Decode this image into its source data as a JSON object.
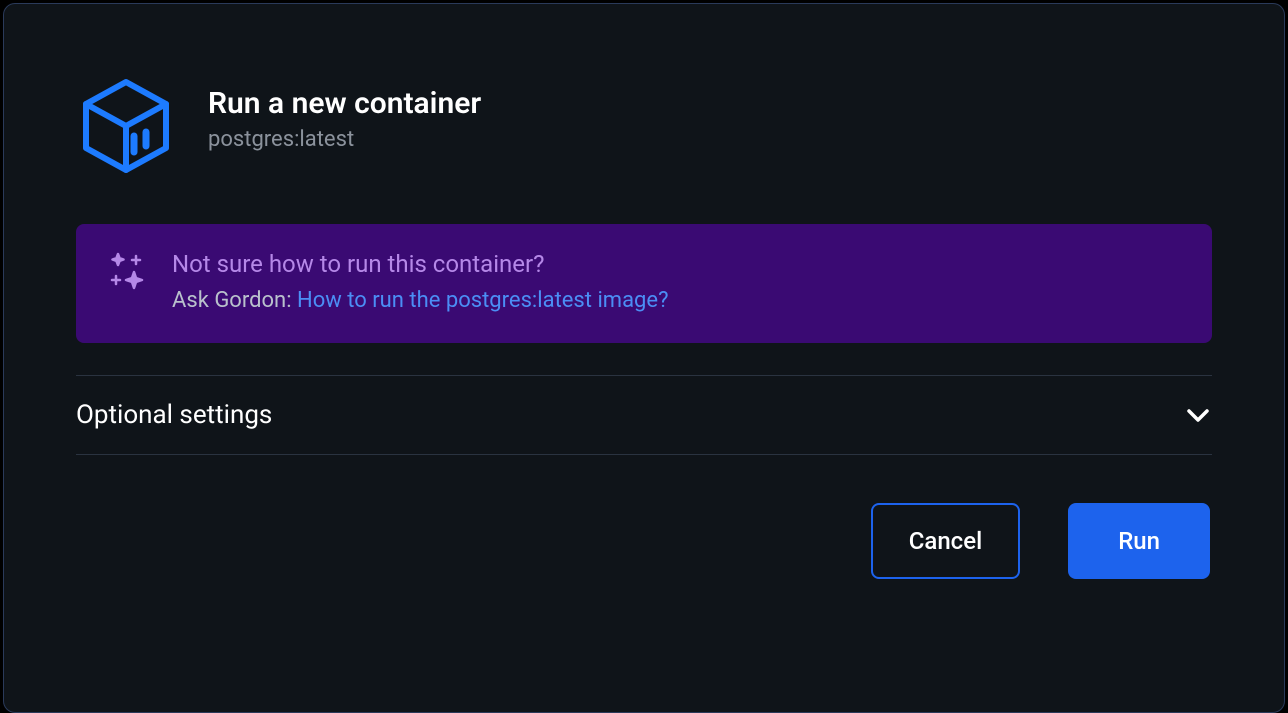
{
  "dialog": {
    "title": "Run a new container",
    "image_name": "postgres:latest"
  },
  "help_banner": {
    "title": "Not sure how to run this container?",
    "prompt_prefix": "Ask Gordon: ",
    "prompt_link": "How to run the postgres:latest image?"
  },
  "settings": {
    "label": "Optional settings"
  },
  "actions": {
    "cancel_label": "Cancel",
    "run_label": "Run"
  },
  "colors": {
    "accent_blue": "#1d63ed",
    "banner_purple": "#3a0a73",
    "banner_text": "#b588e8",
    "link_blue": "#4b8ef5"
  }
}
